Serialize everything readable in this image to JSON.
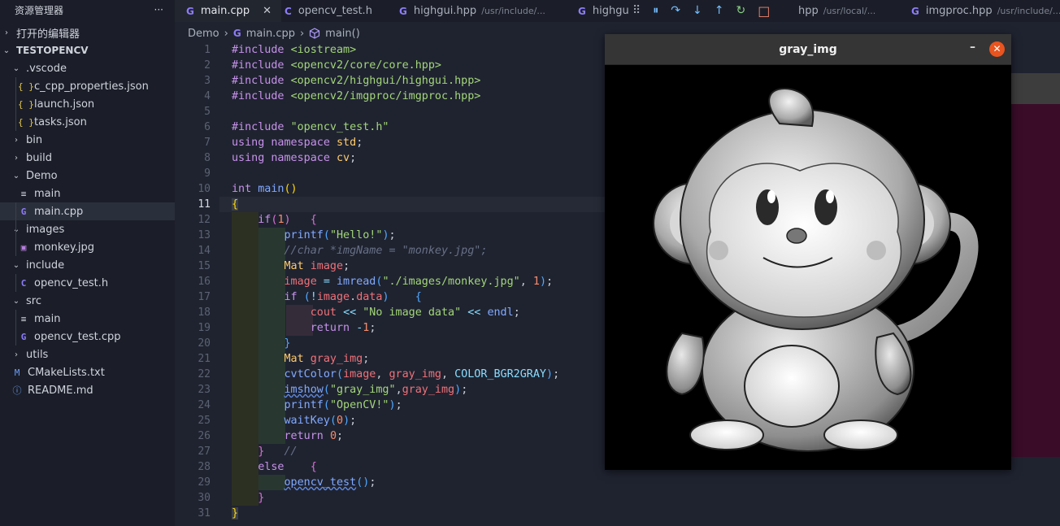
{
  "sidebar": {
    "title": "资源管理器",
    "more": "···",
    "sections": [
      {
        "label": "打开的编辑器",
        "chev": "›"
      },
      {
        "label": "TESTOPENCV",
        "chev": "⌄"
      }
    ],
    "tree": [
      {
        "label": ".vscode",
        "kind": "folder-open"
      },
      {
        "label": "c_cpp_properties.json",
        "kind": "json"
      },
      {
        "label": "launch.json",
        "kind": "json"
      },
      {
        "label": "tasks.json",
        "kind": "json"
      },
      {
        "label": "bin",
        "kind": "folder"
      },
      {
        "label": "build",
        "kind": "folder"
      },
      {
        "label": "Demo",
        "kind": "folder-open"
      },
      {
        "label": "main",
        "kind": "file"
      },
      {
        "label": "main.cpp",
        "kind": "cpp"
      },
      {
        "label": "images",
        "kind": "folder-open"
      },
      {
        "label": "monkey.jpg",
        "kind": "image"
      },
      {
        "label": "include",
        "kind": "folder-open"
      },
      {
        "label": "opencv_test.h",
        "kind": "c"
      },
      {
        "label": "src",
        "kind": "folder-open"
      },
      {
        "label": "main",
        "kind": "file"
      },
      {
        "label": "opencv_test.cpp",
        "kind": "cpp"
      },
      {
        "label": "utils",
        "kind": "folder"
      },
      {
        "label": "CMakeLists.txt",
        "kind": "cmake"
      },
      {
        "label": "README.md",
        "kind": "info"
      }
    ]
  },
  "tabs": [
    {
      "label": "main.cpp",
      "icon": "G",
      "path": "",
      "active": true
    },
    {
      "label": "opencv_test.h",
      "icon": "C",
      "path": ""
    },
    {
      "label": "highgui.hpp",
      "icon": "G",
      "path": "/usr/include/..."
    },
    {
      "label": "highgu",
      "icon": "G",
      "path": ""
    },
    {
      "label": "hpp",
      "icon": "",
      "path": "/usr/local/..."
    },
    {
      "label": "imgproc.hpp",
      "icon": "G",
      "path": "/usr/include/..."
    }
  ],
  "tab_close": "✕",
  "debug": {
    "grip": "⠿",
    "pause": "⏸",
    "step_over": "↷",
    "step_into": "↓",
    "step_out": "↑",
    "restart": "↻",
    "stop": "□"
  },
  "breadcrumb": {
    "folder": "Demo",
    "file": "main.cpp",
    "symbol": "main()",
    "sep": "›"
  },
  "code_lines": [
    "1",
    "2",
    "3",
    "4",
    "5",
    "6",
    "7",
    "8",
    "9",
    "10",
    "11",
    "12",
    "13",
    "14",
    "15",
    "16",
    "17",
    "18",
    "19",
    "20",
    "21",
    "22",
    "23",
    "24",
    "25",
    "26",
    "27",
    "28",
    "29",
    "30",
    "31"
  ],
  "current_line": 11,
  "window": {
    "title": "gray_img",
    "minimize": "–",
    "close": "✕"
  },
  "colors": {
    "accent": "#8d7cf8",
    "close": "#e9541f"
  }
}
